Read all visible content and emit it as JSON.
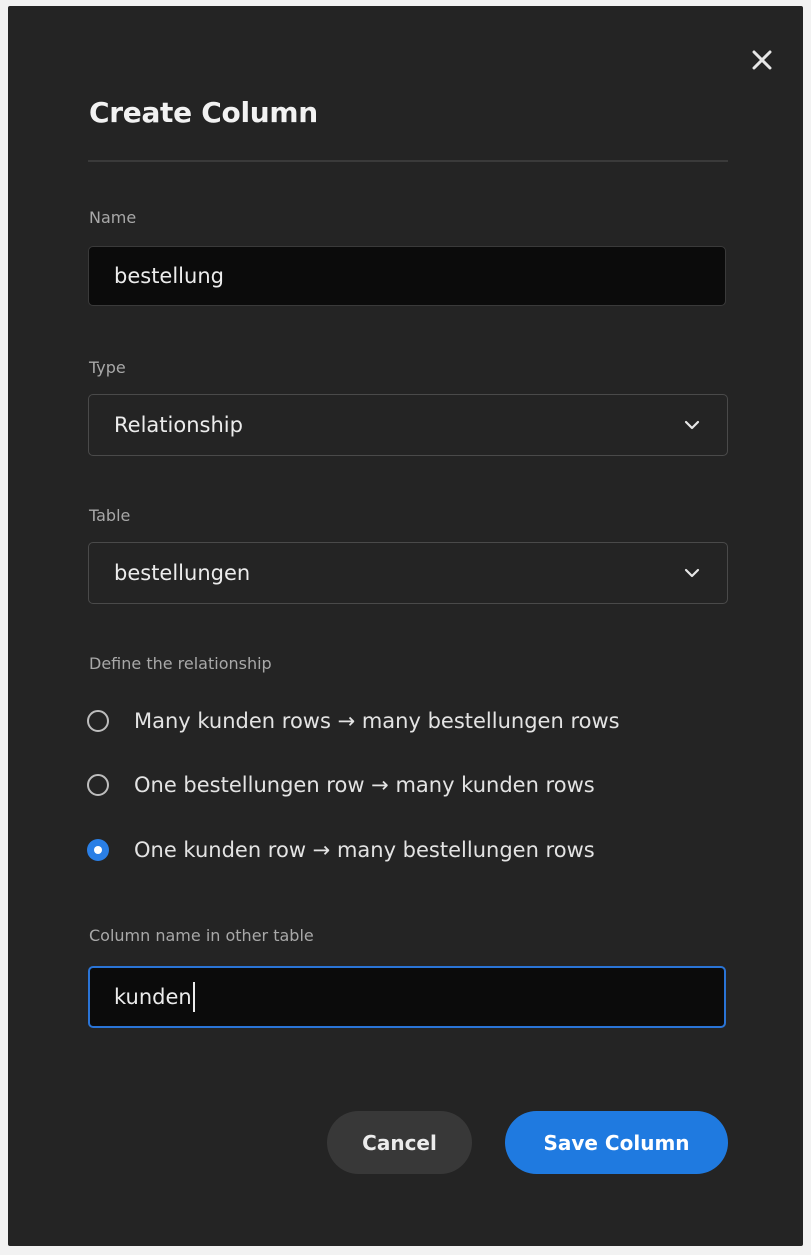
{
  "dialog": {
    "title": "Create Column",
    "close_icon": "close-icon"
  },
  "name_field": {
    "label": "Name",
    "value": "bestellung"
  },
  "type_field": {
    "label": "Type",
    "value": "Relationship",
    "icon": "chevron-down-icon"
  },
  "table_field": {
    "label": "Table",
    "value": "bestellungen",
    "icon": "chevron-down-icon"
  },
  "relationship": {
    "label": "Define the relationship",
    "options": [
      {
        "label": "Many kunden rows → many bestellungen rows",
        "checked": false
      },
      {
        "label": "One bestellungen row → many kunden rows",
        "checked": false
      },
      {
        "label": "One kunden row → many bestellungen rows",
        "checked": true
      }
    ]
  },
  "other_column_field": {
    "label": "Column name in other table",
    "value": "kunden"
  },
  "buttons": {
    "cancel_label": "Cancel",
    "save_label": "Save Column"
  },
  "colors": {
    "modal_background": "#242424",
    "input_background": "#0b0b0b",
    "accent": "#1f7ae0",
    "focus_border": "#2a74d6",
    "secondary_button": "#383838"
  }
}
